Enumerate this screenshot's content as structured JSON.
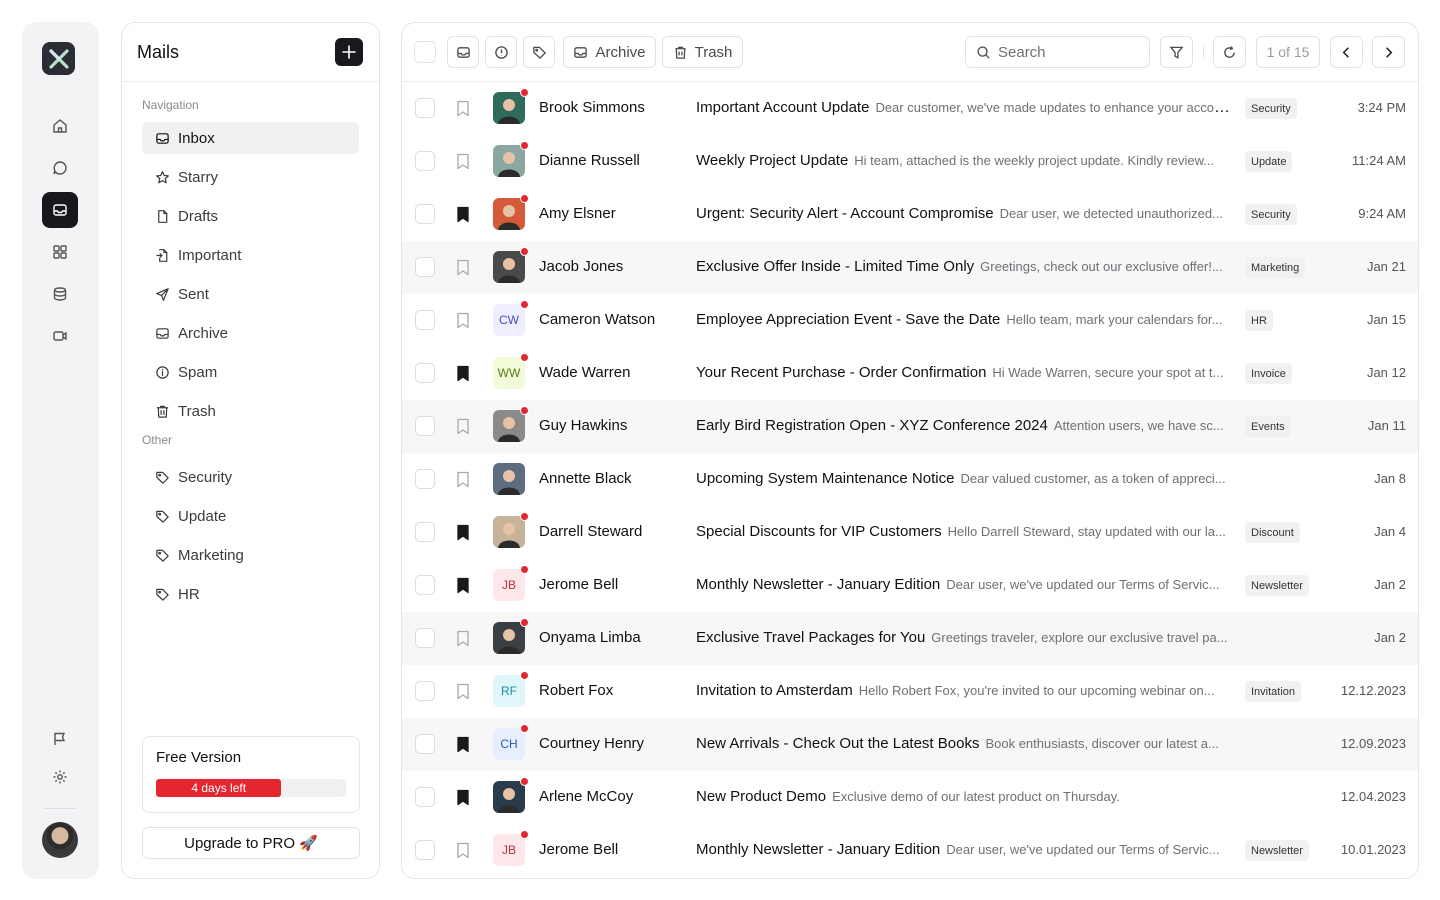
{
  "sidebar": {
    "title": "Mails",
    "nav_section": "Navigation",
    "other_section": "Other",
    "nav": [
      {
        "label": "Inbox",
        "icon": "inbox-icon"
      },
      {
        "label": "Starry",
        "icon": "star-icon"
      },
      {
        "label": "Drafts",
        "icon": "file-icon"
      },
      {
        "label": "Important",
        "icon": "important-file-icon"
      },
      {
        "label": "Sent",
        "icon": "send-icon"
      },
      {
        "label": "Archive",
        "icon": "archive-icon"
      },
      {
        "label": "Spam",
        "icon": "info-icon"
      },
      {
        "label": "Trash",
        "icon": "trash-icon"
      }
    ],
    "other": [
      {
        "label": "Security",
        "icon": "tag-icon"
      },
      {
        "label": "Update",
        "icon": "tag-icon"
      },
      {
        "label": "Marketing",
        "icon": "tag-icon"
      },
      {
        "label": "HR",
        "icon": "tag-icon"
      }
    ],
    "trial": {
      "title": "Free Version",
      "days_left": "4 days left",
      "progress_fraction": 0.66
    },
    "upgrade_label": "Upgrade to PRO 🚀"
  },
  "toolbar": {
    "archive_label": "Archive",
    "trash_label": "Trash",
    "search_placeholder": "Search",
    "pager": "1 of 15"
  },
  "colors": {
    "accent": "#e3262f",
    "dark": "#17191d"
  },
  "emails": [
    {
      "sender": "Brook Simmons",
      "subject": "Important Account Update",
      "preview": "Dear customer, we've made updates to enhance your account...",
      "tag": "Security",
      "date": "3:24 PM",
      "bookmarked": false,
      "avatar": "photo",
      "initials": "",
      "unread": true
    },
    {
      "sender": "Dianne Russell",
      "subject": "Weekly Project Update",
      "preview": "Hi team, attached is the weekly project update. Kindly review...",
      "tag": "Update",
      "date": "11:24 AM",
      "bookmarked": false,
      "avatar": "photo",
      "initials": "",
      "unread": true
    },
    {
      "sender": "Amy Elsner",
      "subject": "Urgent: Security Alert - Account Compromise",
      "preview": "Dear user, we detected unauthorized...",
      "tag": "Security",
      "date": "9:24 AM",
      "bookmarked": true,
      "avatar": "photo",
      "initials": "",
      "unread": true
    },
    {
      "sender": "Jacob Jones",
      "subject": "Exclusive Offer Inside - Limited Time Only",
      "preview": "Greetings, check out our exclusive offer!...",
      "tag": "Marketing",
      "date": "Jan 21",
      "bookmarked": false,
      "avatar": "photo",
      "initials": "",
      "unread": true
    },
    {
      "sender": "Cameron Watson",
      "subject": "Employee Appreciation Event - Save the Date",
      "preview": "Hello team, mark your calendars for...",
      "tag": "HR",
      "date": "Jan 15",
      "bookmarked": false,
      "avatar": "initials",
      "initials": "CW",
      "unread": true
    },
    {
      "sender": "Wade Warren",
      "subject": "Your Recent Purchase - Order Confirmation",
      "preview": "Hi Wade Warren, secure your spot at t...",
      "tag": "Invoice",
      "date": "Jan 12",
      "bookmarked": true,
      "avatar": "initials",
      "initials": "WW",
      "unread": true
    },
    {
      "sender": "Guy Hawkins",
      "subject": "Early Bird Registration Open - XYZ Conference 2024",
      "preview": "Attention users, we have sc...",
      "tag": "Events",
      "date": "Jan 11",
      "bookmarked": false,
      "avatar": "photo",
      "initials": "",
      "unread": true
    },
    {
      "sender": "Annette Black",
      "subject": "Upcoming System Maintenance Notice",
      "preview": "Dear valued customer, as a token of appreci...",
      "tag": "",
      "date": "Jan 8",
      "bookmarked": false,
      "avatar": "photo",
      "initials": "",
      "unread": false
    },
    {
      "sender": "Darrell Steward",
      "subject": "Special Discounts for VIP Customers",
      "preview": "Hello Darrell Steward, stay updated with our la...",
      "tag": "Discount",
      "date": "Jan 4",
      "bookmarked": true,
      "avatar": "photo",
      "initials": "",
      "unread": true
    },
    {
      "sender": "Jerome Bell",
      "subject": "Monthly Newsletter - January Edition",
      "preview": "Dear user, we've updated our Terms of Servic...",
      "tag": "Newsletter",
      "date": "Jan 2",
      "bookmarked": true,
      "avatar": "initials",
      "initials": "JB",
      "unread": true
    },
    {
      "sender": "Onyama Limba",
      "subject": "Exclusive Travel Packages for You",
      "preview": "Greetings traveler, explore our exclusive travel pa...",
      "tag": "",
      "date": "Jan 2",
      "bookmarked": false,
      "avatar": "photo",
      "initials": "",
      "unread": true
    },
    {
      "sender": "Robert Fox",
      "subject": "Invitation to Amsterdam",
      "preview": "Hello Robert Fox, you're invited to our upcoming webinar on...",
      "tag": "Invitation",
      "date": "12.12.2023",
      "bookmarked": false,
      "avatar": "initials",
      "initials": "RF",
      "unread": true
    },
    {
      "sender": "Courtney Henry",
      "subject": "New Arrivals - Check Out the Latest Books",
      "preview": "Book enthusiasts, discover our latest a...",
      "tag": "",
      "date": "12.09.2023",
      "bookmarked": true,
      "avatar": "initials",
      "initials": "CH",
      "unread": true
    },
    {
      "sender": "Arlene McCoy",
      "subject": "New Product Demo",
      "preview": "Exclusive demo of our latest product on Thursday.",
      "tag": "",
      "date": "12.04.2023",
      "bookmarked": true,
      "avatar": "photo",
      "initials": "",
      "unread": true
    },
    {
      "sender": "Jerome Bell",
      "subject": "Monthly Newsletter - January Edition",
      "preview": "Dear user, we've updated our Terms of Servic...",
      "tag": "Newsletter",
      "date": "10.01.2023",
      "bookmarked": false,
      "avatar": "initials",
      "initials": "JB",
      "unread": true
    }
  ]
}
